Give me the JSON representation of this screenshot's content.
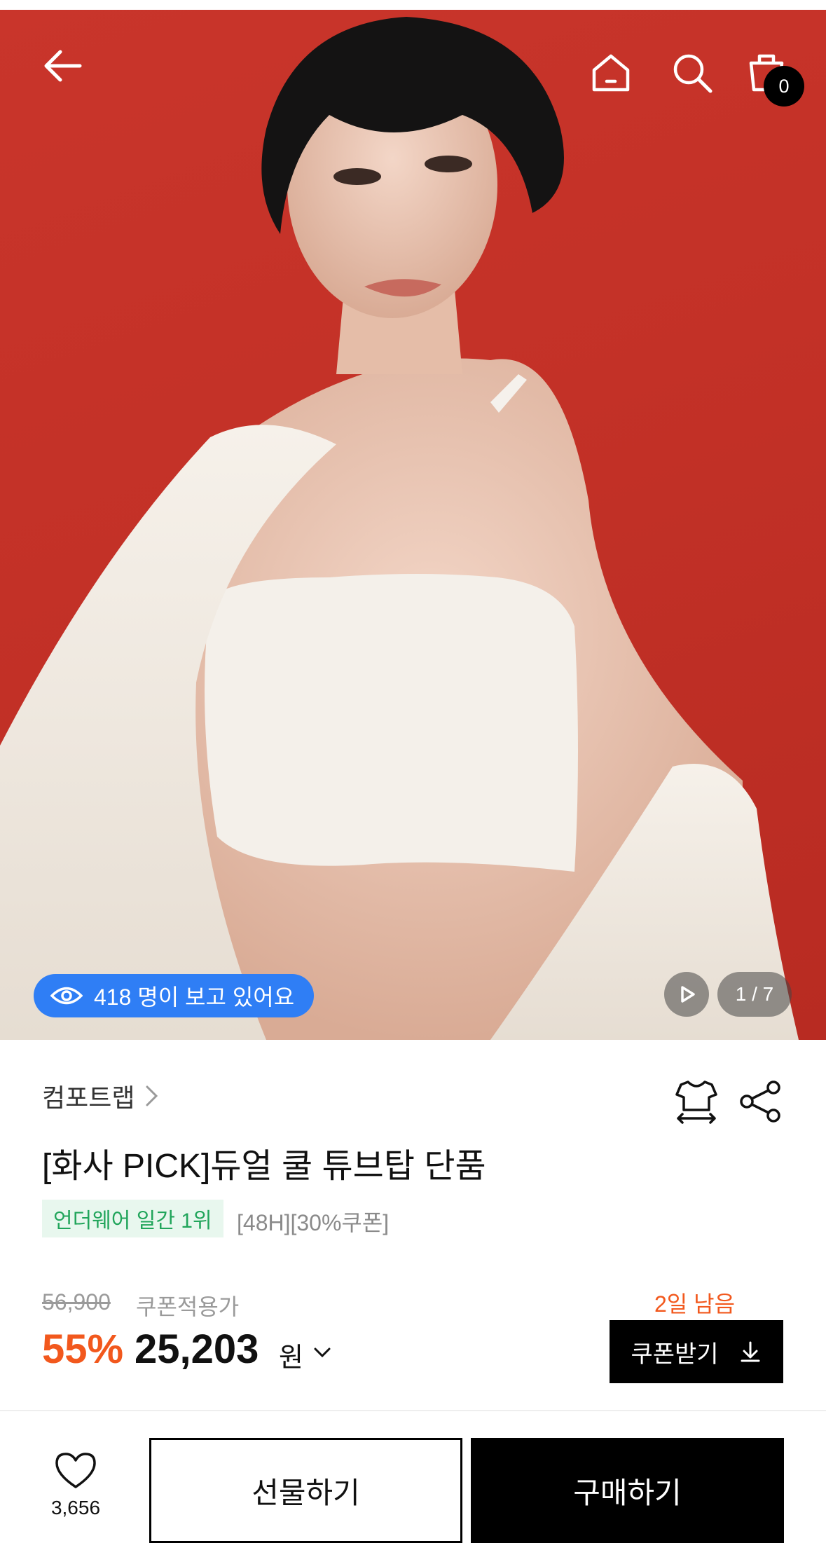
{
  "header": {
    "back_icon": "arrow-left-icon",
    "home_icon": "home-icon",
    "search_icon": "search-icon",
    "cart_icon": "shopping-bag-icon",
    "cart_count": "0"
  },
  "gallery": {
    "viewers_text": "418 명이 보고 있어요",
    "viewers_icon": "eye-icon",
    "play_icon": "play-icon",
    "counter": "1 / 7"
  },
  "product": {
    "brand": "컴포트랩",
    "title": "[화사 PICK]듀얼 쿨 튜브탑 단품",
    "rank_badge": "언더웨어 일간 1위",
    "promo_tags": "[48H][30%쿠폰]",
    "original_price": "56,900",
    "coupon_label": "쿠폰적용가",
    "discount": "55%",
    "price": "25,203",
    "currency": "원",
    "days_left": "2일 남음",
    "coupon_button": "쿠폰받기"
  },
  "bottom_bar": {
    "like_count": "3,656",
    "gift_button": "선물하기",
    "buy_button": "구매하기"
  },
  "colors": {
    "hero_bg": "#c9352b",
    "accent_orange": "#f2581d",
    "viewer_blue": "#2f7ef5",
    "rank_green": "#21a55b"
  }
}
